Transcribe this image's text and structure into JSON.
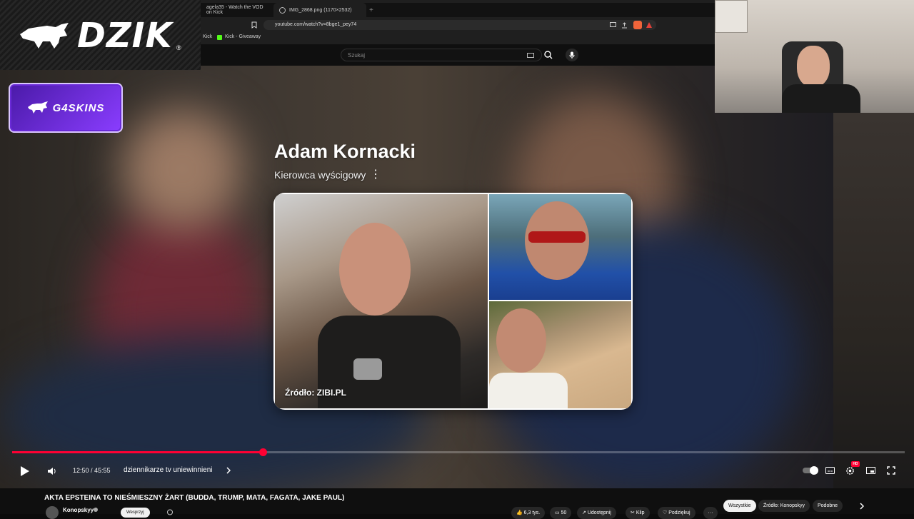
{
  "overlay": {
    "brand_logo_text": "DZIK",
    "registered_mark": "®",
    "sponsor_text": "G4SKINS"
  },
  "browser": {
    "tabs": [
      {
        "label": "agela35 - Watch the VOD on Kick"
      },
      {
        "label": "IMG_2868.png (1170×2532)"
      }
    ],
    "new_tab_icon": "plus-icon",
    "url": "youtube.com/watch?v=8bge1_pey74",
    "bookmarks": [
      {
        "label": "Kick"
      },
      {
        "label": "Kick - Giveaway"
      }
    ]
  },
  "youtube": {
    "search_placeholder": "Szukaj"
  },
  "knowledge_card": {
    "name": "Adam Kornacki",
    "subtitle": "Kierowca wyścigowy",
    "more_icon": "vertical-dots-icon",
    "source": "Źródło: ZIBI.PL",
    "image_icon": "image-icon"
  },
  "player": {
    "progress_fraction": 0.281,
    "time_display": "12:50 / 45:55",
    "chapter": "dziennikarze tv uniewinnieni",
    "hd_badge": "HD"
  },
  "video": {
    "title": "AKTA EPSTEINA TO NIEŚMIESZNY ŻART (BUDDA, TRUMP, MATA, FAGATA, JAKE PAUL)",
    "channel": "Konopskyy",
    "subscribe_label": "Wesprzyj",
    "likes": "6,3 tys.",
    "comments": "50",
    "share_label": "Udostępnij",
    "clip_label": "Klip",
    "thanks_label": "Podziękuj",
    "chips": [
      {
        "label": "Wszystkie",
        "active": true
      },
      {
        "label": "Źródło: Konopskyy",
        "active": false
      },
      {
        "label": "Podobne",
        "active": false
      }
    ]
  },
  "colors": {
    "accent_red": "#ff0033",
    "sponsor_purple": "#8a3dff",
    "youtube_dark": "#0f0f0f"
  }
}
